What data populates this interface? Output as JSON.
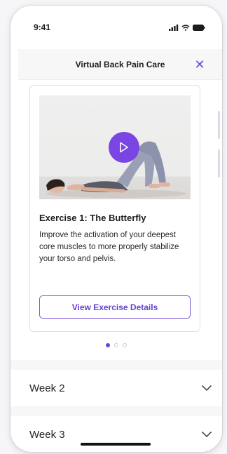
{
  "status_bar": {
    "time": "9:41"
  },
  "header": {
    "title": "Virtual Back Pain Care",
    "close_glyph": "✕"
  },
  "exercise_card": {
    "title": "Exercise 1: The Butterfly",
    "description": "Improve the activation of your deepest core muscles to more properly stabilize your torso and pelvis.",
    "details_button": "View Exercise Details"
  },
  "carousel": {
    "total": 3,
    "active_index": 0
  },
  "weeks": [
    {
      "label": "Week 2"
    },
    {
      "label": "Week 3"
    }
  ],
  "colors": {
    "accent": "#7047e0",
    "play_button": "#7a45e2",
    "background": "#f7f7f8"
  }
}
